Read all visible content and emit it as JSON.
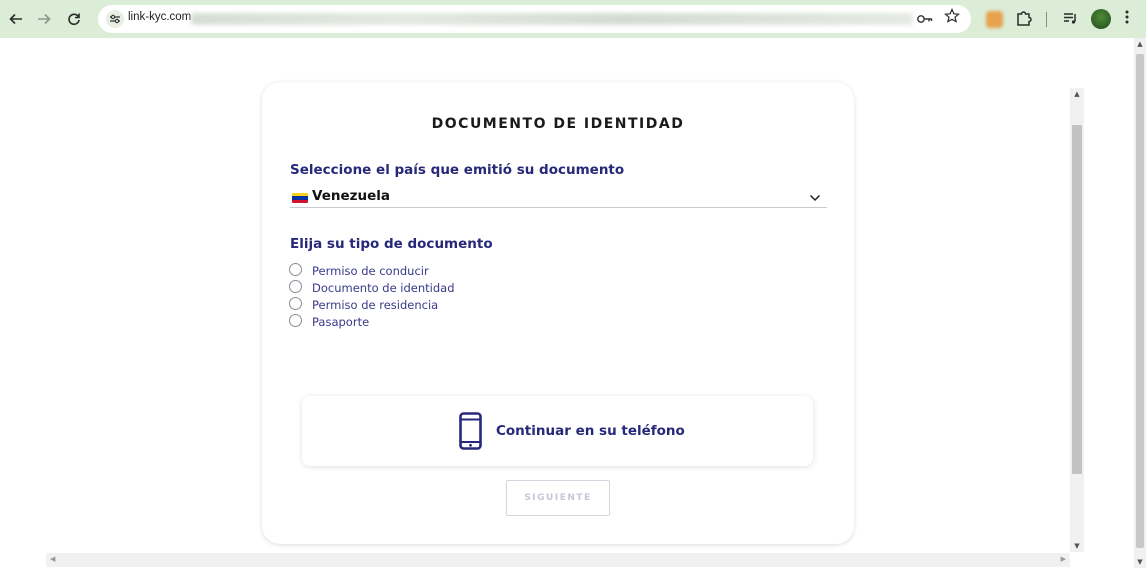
{
  "browser": {
    "url_host": "link-kyc.com",
    "icons": {
      "back": "arrow-left-icon",
      "forward": "arrow-right-icon",
      "reload": "reload-icon",
      "site_info": "tune-icon",
      "password": "key-icon",
      "bookmark": "star-icon",
      "extensions": "puzzle-icon",
      "media": "queue-music-icon",
      "menu": "kebab-menu-icon"
    },
    "colors": {
      "toolbar_bg": "#dbedd6"
    }
  },
  "page": {
    "title": "DOCUMENTO DE IDENTIDAD",
    "country_question": "Seleccione el país que emitió su documento",
    "country": {
      "selected": "Venezuela",
      "flag": "venezuela-flag"
    },
    "doc_type_question": "Elija su tipo de documento",
    "doc_types": [
      {
        "label": "Permiso de conducir",
        "selected": false
      },
      {
        "label": "Documento de identidad",
        "selected": false
      },
      {
        "label": "Permiso de residencia",
        "selected": false
      },
      {
        "label": "Pasaporte",
        "selected": false
      }
    ],
    "continue_phone": {
      "label": "Continuar en su teléfono",
      "icon": "smartphone-icon"
    },
    "next_button": {
      "label": "SIGUIENTE",
      "enabled": false
    },
    "colors": {
      "accent": "#27287a",
      "disabled_text": "#c6c6d6"
    }
  }
}
